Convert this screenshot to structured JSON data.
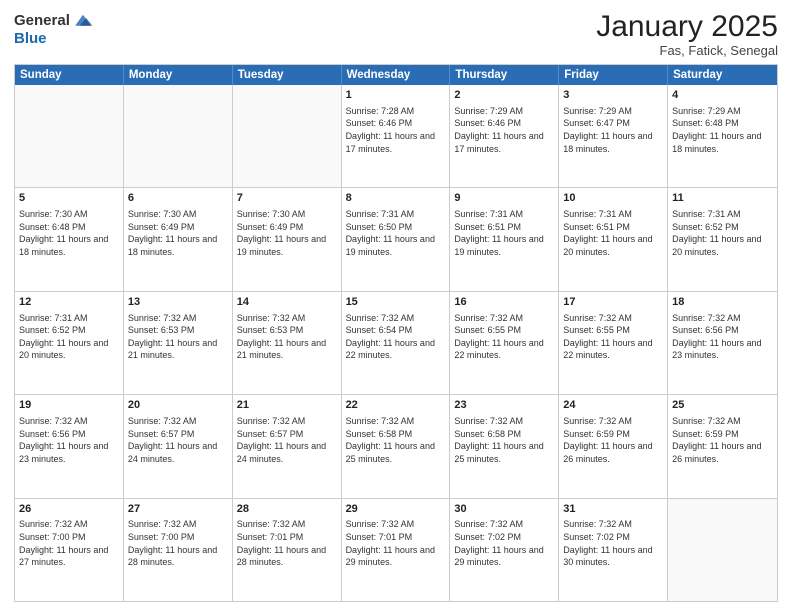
{
  "logo": {
    "general": "General",
    "blue": "Blue"
  },
  "title": "January 2025",
  "location": "Fas, Fatick, Senegal",
  "days": [
    "Sunday",
    "Monday",
    "Tuesday",
    "Wednesday",
    "Thursday",
    "Friday",
    "Saturday"
  ],
  "weeks": [
    [
      {
        "day": "",
        "text": "",
        "empty": true
      },
      {
        "day": "",
        "text": "",
        "empty": true
      },
      {
        "day": "",
        "text": "",
        "empty": true
      },
      {
        "day": "1",
        "text": "Sunrise: 7:28 AM\nSunset: 6:46 PM\nDaylight: 11 hours and 17 minutes.",
        "empty": false
      },
      {
        "day": "2",
        "text": "Sunrise: 7:29 AM\nSunset: 6:46 PM\nDaylight: 11 hours and 17 minutes.",
        "empty": false
      },
      {
        "day": "3",
        "text": "Sunrise: 7:29 AM\nSunset: 6:47 PM\nDaylight: 11 hours and 18 minutes.",
        "empty": false
      },
      {
        "day": "4",
        "text": "Sunrise: 7:29 AM\nSunset: 6:48 PM\nDaylight: 11 hours and 18 minutes.",
        "empty": false
      }
    ],
    [
      {
        "day": "5",
        "text": "Sunrise: 7:30 AM\nSunset: 6:48 PM\nDaylight: 11 hours and 18 minutes.",
        "empty": false
      },
      {
        "day": "6",
        "text": "Sunrise: 7:30 AM\nSunset: 6:49 PM\nDaylight: 11 hours and 18 minutes.",
        "empty": false
      },
      {
        "day": "7",
        "text": "Sunrise: 7:30 AM\nSunset: 6:49 PM\nDaylight: 11 hours and 19 minutes.",
        "empty": false
      },
      {
        "day": "8",
        "text": "Sunrise: 7:31 AM\nSunset: 6:50 PM\nDaylight: 11 hours and 19 minutes.",
        "empty": false
      },
      {
        "day": "9",
        "text": "Sunrise: 7:31 AM\nSunset: 6:51 PM\nDaylight: 11 hours and 19 minutes.",
        "empty": false
      },
      {
        "day": "10",
        "text": "Sunrise: 7:31 AM\nSunset: 6:51 PM\nDaylight: 11 hours and 20 minutes.",
        "empty": false
      },
      {
        "day": "11",
        "text": "Sunrise: 7:31 AM\nSunset: 6:52 PM\nDaylight: 11 hours and 20 minutes.",
        "empty": false
      }
    ],
    [
      {
        "day": "12",
        "text": "Sunrise: 7:31 AM\nSunset: 6:52 PM\nDaylight: 11 hours and 20 minutes.",
        "empty": false
      },
      {
        "day": "13",
        "text": "Sunrise: 7:32 AM\nSunset: 6:53 PM\nDaylight: 11 hours and 21 minutes.",
        "empty": false
      },
      {
        "day": "14",
        "text": "Sunrise: 7:32 AM\nSunset: 6:53 PM\nDaylight: 11 hours and 21 minutes.",
        "empty": false
      },
      {
        "day": "15",
        "text": "Sunrise: 7:32 AM\nSunset: 6:54 PM\nDaylight: 11 hours and 22 minutes.",
        "empty": false
      },
      {
        "day": "16",
        "text": "Sunrise: 7:32 AM\nSunset: 6:55 PM\nDaylight: 11 hours and 22 minutes.",
        "empty": false
      },
      {
        "day": "17",
        "text": "Sunrise: 7:32 AM\nSunset: 6:55 PM\nDaylight: 11 hours and 22 minutes.",
        "empty": false
      },
      {
        "day": "18",
        "text": "Sunrise: 7:32 AM\nSunset: 6:56 PM\nDaylight: 11 hours and 23 minutes.",
        "empty": false
      }
    ],
    [
      {
        "day": "19",
        "text": "Sunrise: 7:32 AM\nSunset: 6:56 PM\nDaylight: 11 hours and 23 minutes.",
        "empty": false
      },
      {
        "day": "20",
        "text": "Sunrise: 7:32 AM\nSunset: 6:57 PM\nDaylight: 11 hours and 24 minutes.",
        "empty": false
      },
      {
        "day": "21",
        "text": "Sunrise: 7:32 AM\nSunset: 6:57 PM\nDaylight: 11 hours and 24 minutes.",
        "empty": false
      },
      {
        "day": "22",
        "text": "Sunrise: 7:32 AM\nSunset: 6:58 PM\nDaylight: 11 hours and 25 minutes.",
        "empty": false
      },
      {
        "day": "23",
        "text": "Sunrise: 7:32 AM\nSunset: 6:58 PM\nDaylight: 11 hours and 25 minutes.",
        "empty": false
      },
      {
        "day": "24",
        "text": "Sunrise: 7:32 AM\nSunset: 6:59 PM\nDaylight: 11 hours and 26 minutes.",
        "empty": false
      },
      {
        "day": "25",
        "text": "Sunrise: 7:32 AM\nSunset: 6:59 PM\nDaylight: 11 hours and 26 minutes.",
        "empty": false
      }
    ],
    [
      {
        "day": "26",
        "text": "Sunrise: 7:32 AM\nSunset: 7:00 PM\nDaylight: 11 hours and 27 minutes.",
        "empty": false
      },
      {
        "day": "27",
        "text": "Sunrise: 7:32 AM\nSunset: 7:00 PM\nDaylight: 11 hours and 28 minutes.",
        "empty": false
      },
      {
        "day": "28",
        "text": "Sunrise: 7:32 AM\nSunset: 7:01 PM\nDaylight: 11 hours and 28 minutes.",
        "empty": false
      },
      {
        "day": "29",
        "text": "Sunrise: 7:32 AM\nSunset: 7:01 PM\nDaylight: 11 hours and 29 minutes.",
        "empty": false
      },
      {
        "day": "30",
        "text": "Sunrise: 7:32 AM\nSunset: 7:02 PM\nDaylight: 11 hours and 29 minutes.",
        "empty": false
      },
      {
        "day": "31",
        "text": "Sunrise: 7:32 AM\nSunset: 7:02 PM\nDaylight: 11 hours and 30 minutes.",
        "empty": false
      },
      {
        "day": "",
        "text": "",
        "empty": true
      }
    ]
  ]
}
